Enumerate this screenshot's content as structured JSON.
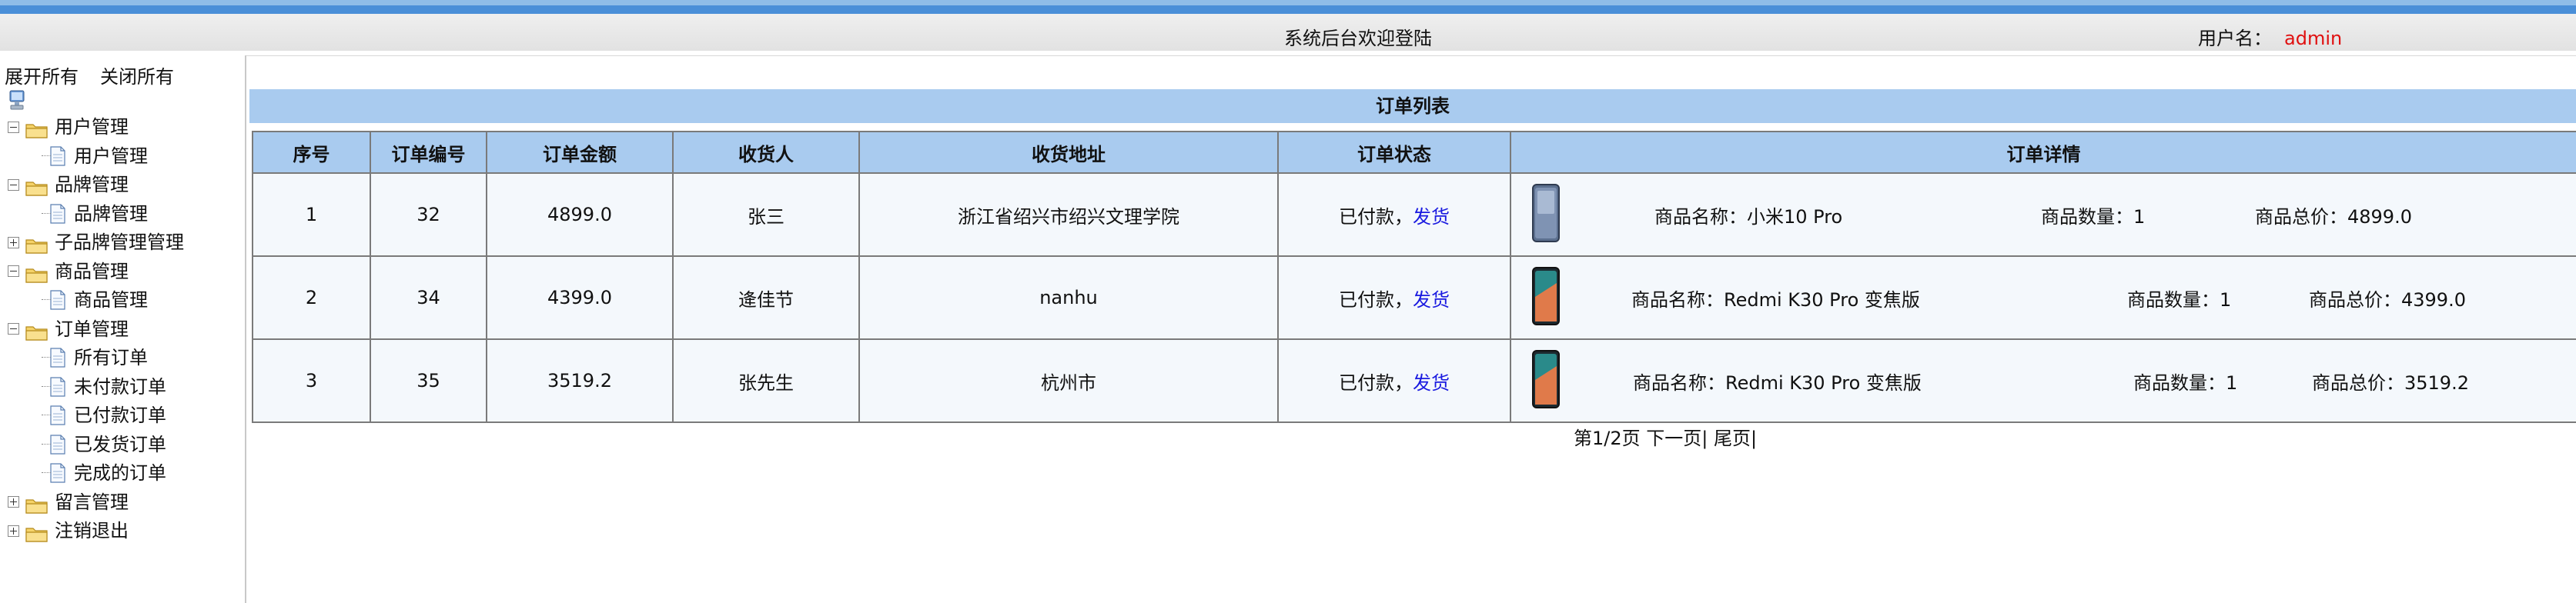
{
  "header": {
    "title": "系统后台欢迎登陆",
    "user_label": "用户名：",
    "username": "admin"
  },
  "sidebar": {
    "expand_all": "展开所有",
    "collapse_all": "关闭所有",
    "tree": [
      {
        "label": "用户管理",
        "open": true,
        "children": [
          "用户管理"
        ]
      },
      {
        "label": "品牌管理",
        "open": true,
        "children": [
          "品牌管理"
        ]
      },
      {
        "label": "子品牌管理管理",
        "open": false,
        "children": []
      },
      {
        "label": "商品管理",
        "open": true,
        "children": [
          "商品管理"
        ]
      },
      {
        "label": "订单管理",
        "open": true,
        "children": [
          "所有订单",
          "未付款订单",
          "已付款订单",
          "已发货订单",
          "完成的订单"
        ]
      },
      {
        "label": "留言管理",
        "open": false,
        "children": []
      },
      {
        "label": "注销退出",
        "open": false,
        "children": []
      }
    ]
  },
  "main": {
    "caption": "订单列表",
    "columns": [
      "序号",
      "订单编号",
      "订单金额",
      "收货人",
      "收货地址",
      "订单状态",
      "订单详情"
    ],
    "rows": [
      {
        "idx": "1",
        "order_no": "32",
        "amount": "4899.0",
        "receiver": "张三",
        "address": "浙江省绍兴市绍兴文理学院",
        "status": "已付款，",
        "action": "发货",
        "product_name": "商品名称：小米10 Pro",
        "product_qty": "商品数量：1",
        "product_total": "商品总价：4899.0",
        "phone_color": "#5b6f8e"
      },
      {
        "idx": "2",
        "order_no": "34",
        "amount": "4399.0",
        "receiver": "逄佳节",
        "address": "nanhu",
        "status": "已付款，",
        "action": "发货",
        "product_name": "商品名称：Redmi K30 Pro 变焦版",
        "product_qty": "商品数量：1",
        "product_total": "商品总价：4399.0",
        "phone_color": "#2a8a8a"
      },
      {
        "idx": "3",
        "order_no": "35",
        "amount": "3519.2",
        "receiver": "张先生",
        "address": "杭州市",
        "status": "已付款，",
        "action": "发货",
        "product_name": "商品名称：Redmi K30 Pro 变焦版",
        "product_qty": "商品数量：1",
        "product_total": "商品总价：3519.2",
        "phone_color": "#2a8a8a"
      }
    ],
    "pager": {
      "info": "第1/2页",
      "next": "下一页",
      "last": "尾页"
    }
  },
  "colors": {
    "header_blue": "#a9cbef",
    "link": "#1a1ae0",
    "username": "#e01010"
  }
}
